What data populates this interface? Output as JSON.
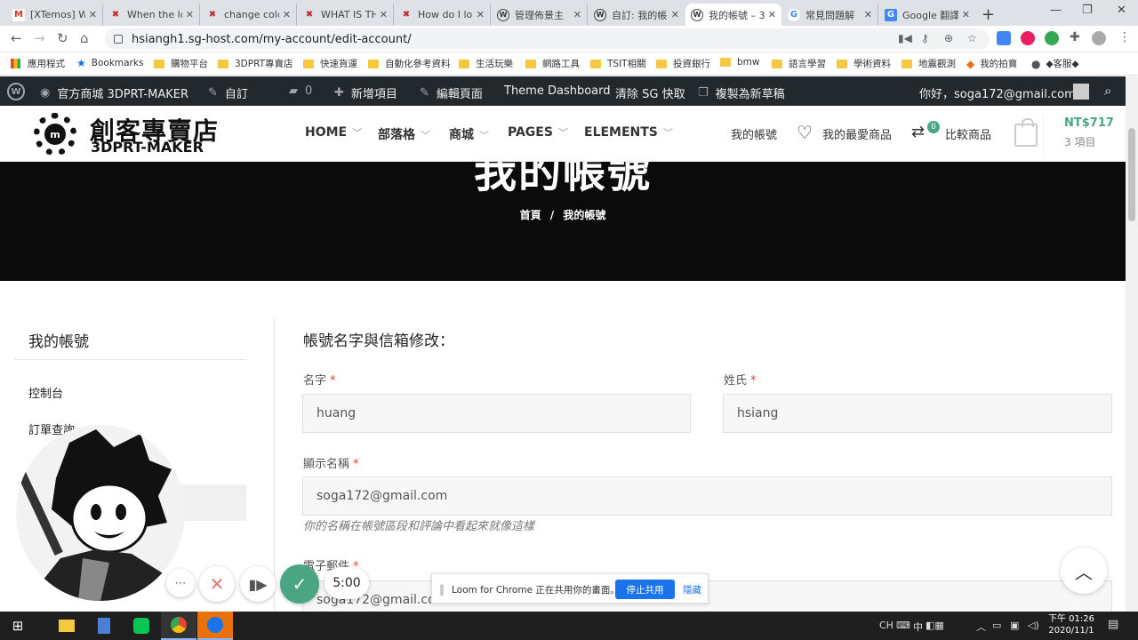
{
  "browser": {
    "tabs": [
      {
        "label": "[XTemos] W",
        "icon": "gmail-icon",
        "glyph": "M"
      },
      {
        "label": "When the lc",
        "icon": "xtemos-icon",
        "glyph": "✖"
      },
      {
        "label": "change colc",
        "icon": "xtemos-icon",
        "glyph": "✖"
      },
      {
        "label": "WHAT IS TH",
        "icon": "xtemos-icon",
        "glyph": "✖"
      },
      {
        "label": "How do I lo",
        "icon": "xtemos-icon",
        "glyph": "✖"
      },
      {
        "label": "管理佈景主",
        "icon": "wordpress-icon",
        "glyph": "W"
      },
      {
        "label": "自訂: 我的帳",
        "icon": "wordpress-icon",
        "glyph": "W"
      },
      {
        "label": "我的帳號 – 3",
        "icon": "wordpress-icon",
        "glyph": "W",
        "active": true
      },
      {
        "label": "常見問題解",
        "icon": "google-icon",
        "glyph": "G"
      },
      {
        "label": "Google 翻譯",
        "icon": "google-translate-icon",
        "glyph": "G"
      }
    ],
    "new_tab": "+",
    "url": "hsiangh1.sg-host.com/my-account/edit-account/",
    "bookmarks": [
      {
        "label": "應用程式",
        "type": "apps"
      },
      {
        "label": "Bookmarks",
        "type": "star"
      },
      {
        "label": "購物平台",
        "type": "folder"
      },
      {
        "label": "3DPRT專賣店",
        "type": "folder"
      },
      {
        "label": "快速貨運",
        "type": "folder"
      },
      {
        "label": "自動化參考資料",
        "type": "folder"
      },
      {
        "label": "生活玩樂",
        "type": "folder"
      },
      {
        "label": "網路工具",
        "type": "folder"
      },
      {
        "label": "TSIT相關",
        "type": "folder"
      },
      {
        "label": "投資銀行",
        "type": "folder"
      },
      {
        "label": "bmw",
        "type": "folder"
      },
      {
        "label": "語言學習",
        "type": "folder"
      },
      {
        "label": "學術資料",
        "type": "folder"
      },
      {
        "label": "地震觀測",
        "type": "folder"
      },
      {
        "label": "我的拍賣",
        "type": "site"
      },
      {
        "label": "◆客服◆",
        "type": "site"
      }
    ]
  },
  "wpbar": {
    "site_name": "官方商城 3DPRT-MAKER",
    "customize": "自訂",
    "comments_count": "0",
    "new_item": "新增項目",
    "edit_page": "編輯頁面",
    "theme_dashboard": "Theme Dashboard",
    "purge_cache": "清除 SG 快取",
    "duplicate": "複製為新草稿",
    "greeting": "你好，soga172@gmail.com"
  },
  "header": {
    "logo_cn": "創客專賣店",
    "logo_en": "3DPRT-MAKER",
    "logo_mark": "m",
    "menu": [
      "HOME",
      "部落格",
      "商城",
      "PAGES",
      "ELEMENTS"
    ],
    "my_account": "我的帳號",
    "wishlist": "我的最愛商品",
    "compare": "比較商品",
    "compare_count": "0",
    "cart_total": "NT$717",
    "cart_items": "3 項目"
  },
  "hero": {
    "title": "我的帳號",
    "breadcrumb_home": "首頁",
    "breadcrumb_sep": "/",
    "breadcrumb_current": "我的帳號"
  },
  "sidebar": {
    "title": "我的帳號",
    "items": [
      "控制台",
      "訂單查詢"
    ]
  },
  "form": {
    "title": "帳號名字與信箱修改：",
    "first_name_label": "名字",
    "first_name_value": "huang",
    "last_name_label": "姓氏",
    "last_name_value": "hsiang",
    "display_name_label": "顯示名稱",
    "display_name_value": "soga172@gmail.com",
    "display_name_hint": "你的名稱在帳號區段和評論中看起來就像這樣",
    "email_label": "電子郵件",
    "email_value": "soga172@gmail.com",
    "required_mark": "*"
  },
  "loom": {
    "message": "Loom for Chrome 正在共用你的畫面。",
    "stop_label": "停止共用",
    "hide_label": "隱藏",
    "timer": "5:00"
  },
  "taskbar": {
    "ime": "CH",
    "ime_mode": "中",
    "time": "下午 01:26",
    "date": "2020/11/1"
  },
  "colors": {
    "accent": "#4aa583",
    "wp_bar": "#23282d",
    "loom_blue": "#1a73e8"
  }
}
